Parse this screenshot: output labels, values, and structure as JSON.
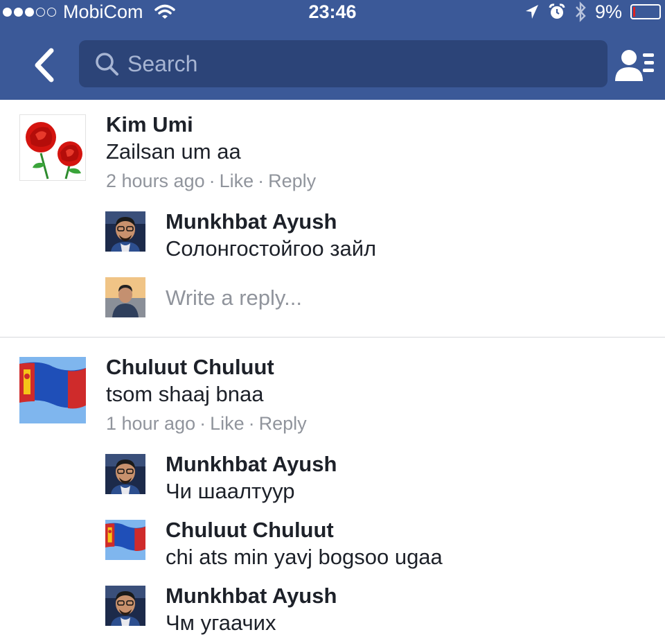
{
  "status": {
    "carrier": "MobiCom",
    "time": "23:46",
    "battery": "9%",
    "battery_level": 0.09,
    "signal_bars_filled": 3,
    "signal_bars_total": 5
  },
  "nav": {
    "search_placeholder": "Search",
    "icons": [
      "back-chevron-icon",
      "search-icon",
      "friends-list-icon"
    ]
  },
  "comments": [
    {
      "author": "Kim Umi",
      "text": "Zailsan um aa",
      "time": "2 hours ago",
      "like": "Like",
      "reply": "Reply",
      "avatar": "roses",
      "replies": [
        {
          "author": "Munkhbat Ayush",
          "text": "Солонгостойгоо зайл",
          "avatar": "man-glasses"
        }
      ],
      "write_reply_placeholder": "Write a reply..."
    },
    {
      "author": "Chuluut Chuluut",
      "text": "tsom shaaj bnaa",
      "time": "1 hour ago",
      "like": "Like",
      "reply": "Reply",
      "avatar": "mongolian-flag",
      "replies": [
        {
          "author": "Munkhbat Ayush",
          "text": "Чи шаалтуур",
          "avatar": "man-glasses"
        },
        {
          "author": "Chuluut Chuluut",
          "text": "chi ats min yavj bogsoo ugaa",
          "avatar": "mongolian-flag"
        },
        {
          "author": "Munkhbat Ayush",
          "text": "Чм угаачих",
          "avatar": "man-glasses"
        }
      ]
    }
  ],
  "colors": {
    "header": "#3b5998",
    "search_bg": "#2c4478",
    "meta_text": "#90949c",
    "divider": "#d6d9dd",
    "battery_low": "#e0221f"
  }
}
